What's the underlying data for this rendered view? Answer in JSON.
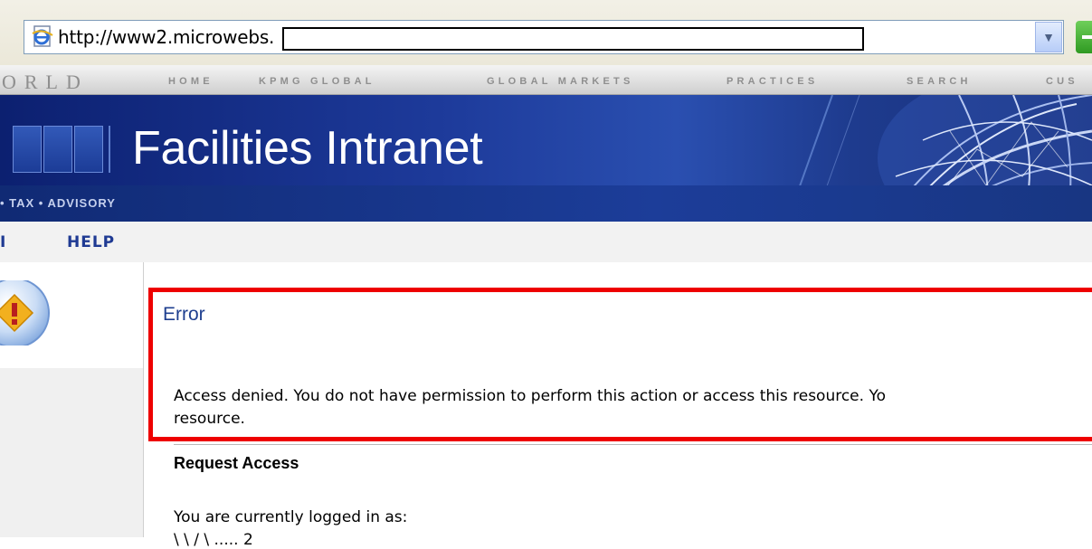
{
  "address_bar": {
    "url": "http://www2.microwebs.",
    "icon": "ie-page-icon"
  },
  "top_nav": {
    "brand_partial": "ORLD",
    "items": [
      "HOME",
      "KPMG GLOBAL",
      "GLOBAL MARKETS",
      "PRACTICES",
      "SEARCH",
      "CUS"
    ]
  },
  "banner": {
    "title": "Facilities Intranet",
    "tagline": "• TAX • ADVISORY"
  },
  "menu": {
    "items": [
      "I",
      "HELP"
    ]
  },
  "error": {
    "title": "Error",
    "message_line1": "Access denied. You do not have permission to perform this action or access this resource. Yo",
    "message_line2": "resource."
  },
  "request": {
    "title": "Request Access",
    "logged_in_text": "You are currently logged in as:",
    "cut_line": "\\ \\ / \\ ..... 2"
  },
  "colors": {
    "banner": "#1d3a9a",
    "error_border": "#ee0000",
    "link_blue": "#1f3a93"
  }
}
